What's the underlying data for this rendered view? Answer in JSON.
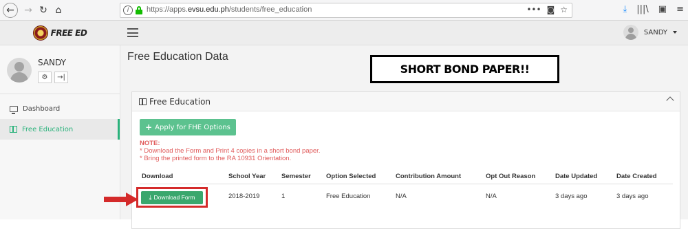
{
  "browser": {
    "url_prefix": "https://apps.",
    "url_host": "evsu.edu.ph",
    "url_path": "/students/free_education"
  },
  "header": {
    "logo_text": "FREE ED",
    "user_name": "SANDY"
  },
  "sidebar": {
    "profile_name": "SANDY",
    "items": [
      {
        "label": "Dashboard"
      },
      {
        "label": "Free Education"
      }
    ]
  },
  "main": {
    "page_title": "Free Education Data",
    "annotation": "SHORT BOND PAPER!!",
    "panel": {
      "title": "Free Education",
      "apply_button": "Apply for FHE Options",
      "note_title": "NOTE:",
      "note_lines": [
        "* Download the Form and Print 4 copies in a short bond paper.",
        "* Bring the printed form to the RA 10931 Orientation."
      ],
      "table": {
        "headers": [
          "Download",
          "School Year",
          "Semester",
          "Option Selected",
          "Contribution Amount",
          "Opt Out Reason",
          "Date Updated",
          "Date Created"
        ],
        "rows": [
          {
            "download_label": "Download Form",
            "school_year": "2018-2019",
            "semester": "1",
            "option_selected": "Free Education",
            "contribution_amount": "N/A",
            "opt_out_reason": "N/A",
            "date_updated": "3 days ago",
            "date_created": "3 days ago"
          }
        ]
      }
    }
  },
  "colors": {
    "accent_green": "#2ab27b",
    "button_green": "#5cc28f",
    "note_red": "#e05a5a",
    "highlight_red": "#d42a2a"
  }
}
